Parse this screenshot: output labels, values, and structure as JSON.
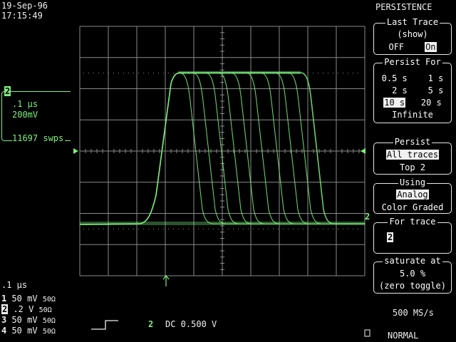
{
  "header": {
    "date": "19-Sep-96",
    "time": "17:15:49",
    "mode_title": "PERSISTENCE"
  },
  "channel_box": {
    "channel": "2",
    "timebase": ".1 μs",
    "volts": "200mV",
    "sweeps": "11697 swps"
  },
  "bottom": {
    "timebase": ".1 μs",
    "channels": [
      {
        "num": "1",
        "volts": "50 mV",
        "imp": "50Ω"
      },
      {
        "num": "2",
        "volts": ".2  V",
        "imp": "50Ω"
      },
      {
        "num": "3",
        "volts": "50 mV",
        "imp": "50Ω"
      },
      {
        "num": "4",
        "volts": "50 mV",
        "imp": "50Ω"
      }
    ],
    "trigger_channel": "2",
    "trigger_coupling": "DC 0.500 V",
    "sample_rate": "500 MS/s",
    "trigger_mode": "NORMAL"
  },
  "menu": {
    "last_trace": {
      "title": "Last Trace",
      "sub": "(show)",
      "off": "OFF",
      "on": "On",
      "selected": "On"
    },
    "persist_for": {
      "title": "Persist For",
      "options": [
        [
          "0.5 s",
          "1 s"
        ],
        [
          "2 s",
          "5 s"
        ],
        [
          "10 s",
          "20 s"
        ]
      ],
      "infinite": "Infinite",
      "selected": "10 s"
    },
    "persist": {
      "title": "Persist",
      "opt1": "All traces",
      "opt2": "Top 2",
      "selected": "All traces"
    },
    "using": {
      "title": "Using",
      "opt1": "Analog",
      "opt2": "Color Graded",
      "selected": "Analog"
    },
    "for_trace": {
      "title": "For trace",
      "value": "2"
    },
    "saturate": {
      "title": "saturate at",
      "value": "5.0 %",
      "hint": "(zero toggle)"
    }
  },
  "trace_label": "2",
  "colors": {
    "trace": "#7cf07c",
    "grid": "#8a8a8a",
    "text": "#f0f0f0",
    "background": "#000000"
  }
}
